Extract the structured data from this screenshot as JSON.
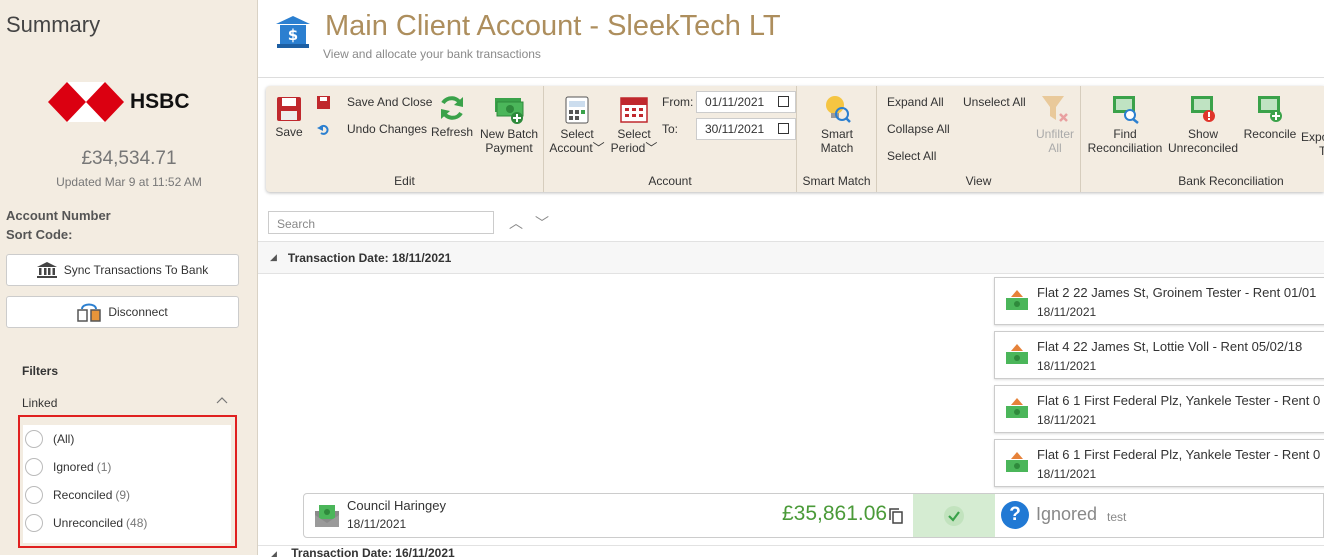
{
  "sidebar": {
    "title": "Summary",
    "bank_name": "HSBC",
    "balance": "£34,534.71",
    "updated": "Updated Mar 9 at 11:52 AM",
    "account_number_label": "Account Number",
    "sort_code_label": "Sort Code:",
    "sync_button": "Sync Transactions To Bank",
    "disconnect_button": "Disconnect",
    "filters_label": "Filters",
    "linked_label": "Linked",
    "options": [
      {
        "label": "(All)",
        "count": ""
      },
      {
        "label": "Ignored",
        "count": "(1)"
      },
      {
        "label": "Reconciled",
        "count": "(9)"
      },
      {
        "label": "Unreconciled",
        "count": "(48)"
      }
    ]
  },
  "header": {
    "title": "Main Client Account - SleekTech LT",
    "subtitle": "View and allocate your bank transactions"
  },
  "ribbon": {
    "edit": {
      "label": "Edit",
      "save": "Save",
      "save_close": "Save And Close",
      "undo": "Undo Changes",
      "refresh": "Refresh",
      "new_batch_1": "New Batch",
      "new_batch_2": "Payment"
    },
    "account": {
      "label": "Account",
      "select_account_1": "Select",
      "select_account_2": "Account",
      "select_period_1": "Select",
      "select_period_2": "Period",
      "from_label": "From:",
      "to_label": "To:",
      "from_value": "01/11/2021",
      "to_value": "30/11/2021"
    },
    "smart_match": {
      "label": "Smart Match",
      "btn_1": "Smart",
      "btn_2": "Match"
    },
    "view": {
      "label": "View",
      "expand_all": "Expand All",
      "collapse_all": "Collapse All",
      "select_all": "Select All",
      "unselect_all": "Unselect All",
      "unfilter_1": "Unfilter",
      "unfilter_2": "All"
    },
    "bank_reconciliation": {
      "label": "Bank Reconciliation",
      "find_1": "Find",
      "find_2": "Reconciliation",
      "show_1": "Show",
      "show_2": "Unreconciled",
      "reconcile": "Reconcile",
      "export_1": "Expo",
      "export_2": "T"
    }
  },
  "search": {
    "placeholder": "Search"
  },
  "groups": [
    {
      "header": "Transaction Date: 18/11/2021"
    },
    {
      "header": "Transaction Date: 16/11/2021"
    }
  ],
  "matches": [
    {
      "desc": "Flat 2 22 James St, Groinem Tester - Rent 01/01",
      "date": "18/11/2021"
    },
    {
      "desc": "Flat 4  22 James St, Lottie Voll - Rent 05/02/18",
      "date": "18/11/2021"
    },
    {
      "desc": "Flat 6 1 First Federal Plz, Yankele Tester - Rent 0",
      "date": "18/11/2021"
    },
    {
      "desc": "Flat 6 1 First Federal Plz, Yankele Tester - Rent 0",
      "date": "18/11/2021"
    }
  ],
  "transaction": {
    "name": "Council Haringey",
    "date": "18/11/2021",
    "amount": "£35,861.06",
    "status": "Ignored",
    "note": "test"
  },
  "colors": {
    "accent": "#ad8e5d",
    "sidebar_bg": "#f3ece1",
    "highlight_border": "#e02020",
    "amount_green": "#4a9a38",
    "info_blue": "#2179d4"
  }
}
